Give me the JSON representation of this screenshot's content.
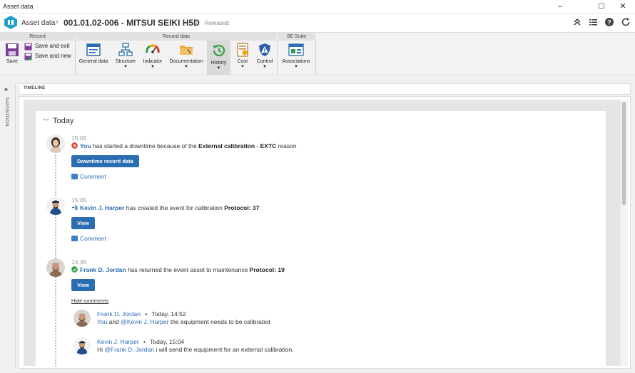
{
  "window": {
    "title": "Asset data",
    "minimize": "–",
    "maximize": "☐",
    "close": "✕"
  },
  "header": {
    "breadcrumb": "Asset data",
    "separator": "›",
    "record_title": "001.01.02-006 - MITSUI SEIKI H5D",
    "pipe": "|",
    "status": "Released",
    "icons": [
      "collapse-icon",
      "list-icon",
      "help-icon",
      "refresh-icon"
    ]
  },
  "ribbon": {
    "groups": [
      {
        "label": "Record"
      },
      {
        "label": "Record data"
      },
      {
        "label": "SE Suite"
      }
    ],
    "save": "Save",
    "save_and_exit": "Save and exit",
    "save_and_new": "Save and new",
    "general_data": "General data",
    "structure": "Structure",
    "indicator": "Indicator",
    "documentation": "Documentation",
    "history": "History",
    "cost": "Cost",
    "control": "Control",
    "associations": "Associations",
    "dropdown_arrow": "▼"
  },
  "navigation": {
    "expand": "»",
    "label": "NAVIGATION"
  },
  "timeline": {
    "panel_title": "TIMELINE",
    "section": "Today",
    "events": [
      {
        "time": "15:06",
        "actor": "You",
        "text_before": " has started a downtime because of the ",
        "bold": "External calibration - EXTC",
        "text_after": " reason",
        "button": "Downtime record data",
        "comment": "Comment"
      },
      {
        "time": "15:05",
        "actor": "Kevin J. Harper",
        "text_before": " has created the event for calibration ",
        "bold": "Protocol: 37",
        "button": "View",
        "comment": "Comment"
      },
      {
        "time": "14:46",
        "actor": "Frank D. Jordan",
        "text_before": " has returned the event asset to maintenance ",
        "bold": "Protocol: 19",
        "button": "View",
        "hide_comments": "Hide comments",
        "comments": [
          {
            "author": "Frank D. Jordan",
            "bullet": "•",
            "when": "Today, 14:52",
            "prefix": "You",
            "middle": " and ",
            "mention": "@Kevin J. Harper",
            "rest": " the equipment needs to be calibrated"
          },
          {
            "author": "Kevin J. Harper",
            "bullet": "•",
            "when": "Today, 15:04",
            "prefix": "Hi ",
            "mention": "@Frank D. Jordan",
            "rest": " i will send the equipment for an external calibration."
          }
        ]
      }
    ]
  },
  "colors": {
    "link_blue": "#2d6db4",
    "button_blue": "#2b6db1",
    "error_red": "#d83b2a",
    "success_green": "#2e9e44"
  }
}
